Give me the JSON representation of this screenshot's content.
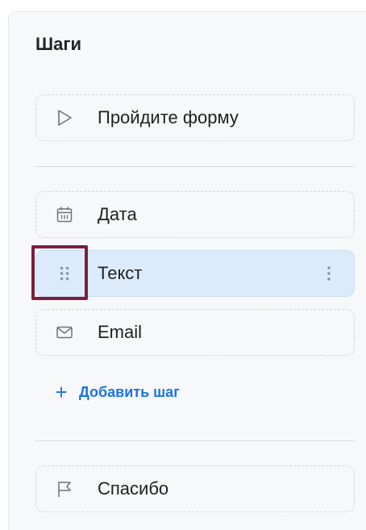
{
  "panel": {
    "title": "Шаги"
  },
  "steps": {
    "intro": {
      "label": "Пройдите форму",
      "icon": "play-triangle-icon"
    },
    "items": [
      {
        "label": "Дата",
        "icon": "calendar-icon"
      },
      {
        "label": "Текст",
        "icon": "drag-handle-icon",
        "selected": true,
        "menu_icon": "more-vertical-icon"
      },
      {
        "label": "Email",
        "icon": "envelope-icon"
      }
    ],
    "add_label": "Добавить шаг",
    "add_icon": "plus-icon",
    "final": {
      "label": "Спасибо",
      "icon": "flag-icon"
    }
  },
  "colors": {
    "accent": "#1a73e8",
    "selected_bg": "#dcebfb",
    "highlight_border": "#7a1f3d",
    "panel_bg": "#f7f8fa"
  }
}
